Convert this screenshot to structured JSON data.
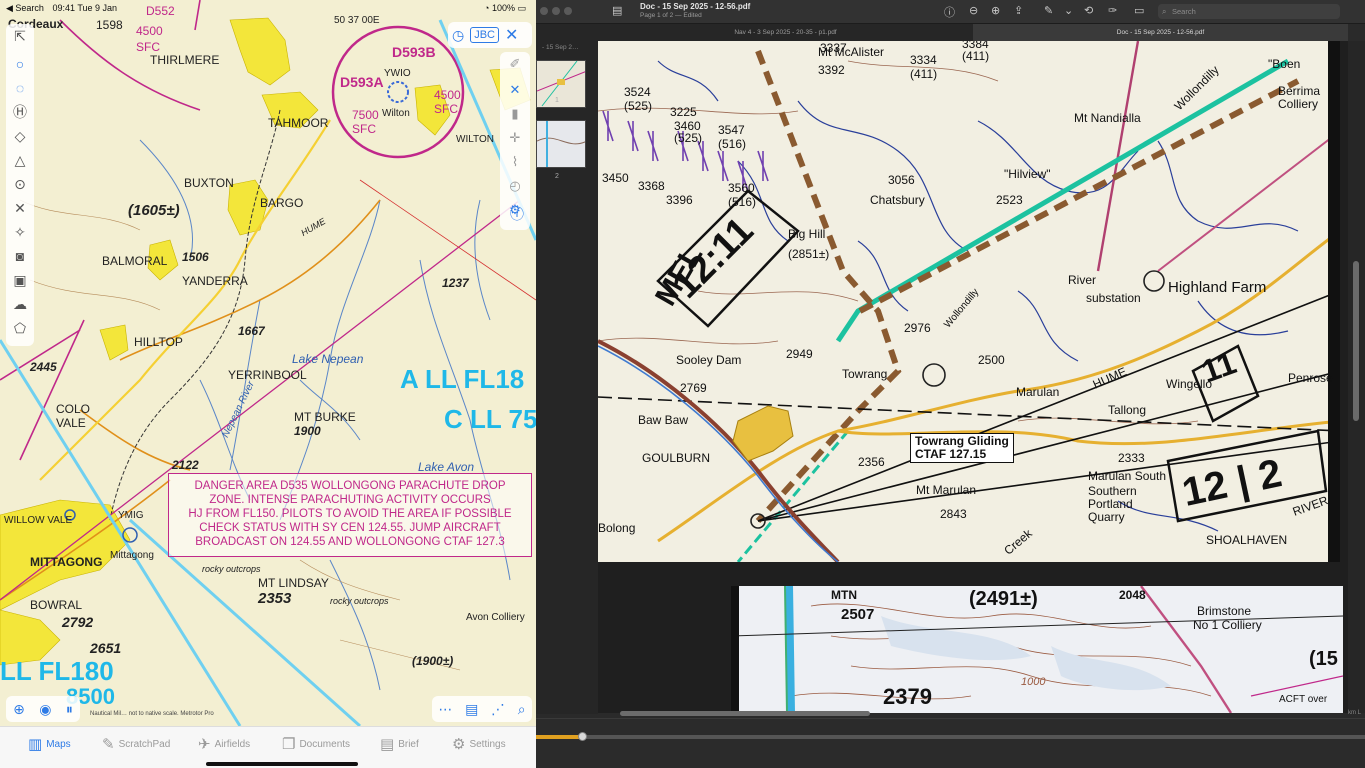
{
  "ipad": {
    "status": {
      "back": "◀ Search",
      "time": "09:41",
      "date": "Tue 9 Jan",
      "battery": "100%"
    },
    "map_labels": [
      {
        "id": "thirlmere",
        "text": "THIRLMERE"
      },
      {
        "id": "tahmoor",
        "text": "TAHMOOR"
      },
      {
        "id": "buxton",
        "text": "BUXTON"
      },
      {
        "id": "bargo",
        "text": "BARGO"
      },
      {
        "id": "balmoral",
        "text": "BALMORAL"
      },
      {
        "id": "yanderra",
        "text": "YANDERRA"
      },
      {
        "id": "hilltop",
        "text": "HILLTOP"
      },
      {
        "id": "yerrinbool",
        "text": "YERRINBOOL"
      },
      {
        "id": "colo",
        "text": "COLO"
      },
      {
        "id": "vale",
        "text": "VALE"
      },
      {
        "id": "willow-vale",
        "text": "WILLOW VALE"
      },
      {
        "id": "mittagong",
        "text": "MITTAGONG"
      },
      {
        "id": "mittagong-ad",
        "text": "Mittagong"
      },
      {
        "id": "ymig",
        "text": "YMIG"
      },
      {
        "id": "bowral",
        "text": "BOWRAL"
      },
      {
        "id": "wilton",
        "text": "Wilton"
      },
      {
        "id": "ywio",
        "text": "YWIO"
      },
      {
        "id": "wilton2",
        "text": "WILTON"
      },
      {
        "id": "mt-burke",
        "text": "MT BURKE"
      },
      {
        "id": "mt-lindsay",
        "text": "MT LINDSAY"
      },
      {
        "id": "lake-nepean",
        "text": "Lake Nepean"
      },
      {
        "id": "lake-avon",
        "text": "Lake Avon"
      },
      {
        "id": "nepean-river",
        "text": "Nepean River"
      },
      {
        "id": "avon-colliery",
        "text": "Avon Colliery"
      },
      {
        "id": "rocky1",
        "text": "rocky outcrops"
      },
      {
        "id": "rocky2",
        "text": "rocky outcrops"
      },
      {
        "id": "hume",
        "text": "HUME"
      },
      {
        "id": "h1605",
        "text": "(1605±)"
      },
      {
        "id": "h1506",
        "text": "1506"
      },
      {
        "id": "h1667",
        "text": "1667"
      },
      {
        "id": "h1900",
        "text": "1900"
      },
      {
        "id": "h2122",
        "text": "2122"
      },
      {
        "id": "h2445",
        "text": "2445"
      },
      {
        "id": "h2353",
        "text": "2353"
      },
      {
        "id": "h2792",
        "text": "2792"
      },
      {
        "id": "h2651",
        "text": "2651"
      },
      {
        "id": "h1237",
        "text": "1237"
      },
      {
        "id": "h1900b",
        "text": "(1900±)"
      },
      {
        "id": "h1598",
        "text": "1598"
      },
      {
        "id": "d593b",
        "text": "D593B"
      },
      {
        "id": "d593a",
        "text": "D593A"
      },
      {
        "id": "s4500a",
        "text": "4500"
      },
      {
        "id": "sfc1",
        "text": "SFC"
      },
      {
        "id": "s4500b",
        "text": "4500"
      },
      {
        "id": "sfc2",
        "text": "SFC"
      },
      {
        "id": "s7500",
        "text": "7500"
      },
      {
        "id": "sfc3",
        "text": "SFC"
      },
      {
        "id": "d552",
        "text": "D552"
      },
      {
        "id": "coord",
        "text": "50 37 00E"
      },
      {
        "id": "a-ll-fl18",
        "text": "A LL FL18"
      },
      {
        "id": "c-ll-75",
        "text": "C LL 75"
      },
      {
        "id": "ll-fl180",
        "text": "LL FL180"
      },
      {
        "id": "n8500",
        "text": "8500"
      },
      {
        "id": "cordeaux",
        "text": "Cordeaux"
      }
    ],
    "danger_box": [
      "DANGER AREA D535 WOLLONGONG PARACHUTE DROP",
      "ZONE. INTENSE PARACHUTING ACTIVITY OCCURS",
      "HJ FROM FL150. PILOTS TO AVOID THE AREA IF POSSIBLE",
      "CHECK STATUS WITH SY CEN 124.55. JUMP AIRCRAFT",
      "BROADCAST ON 124.55 AND WOLLONGONG CTAF 127.3"
    ],
    "pill": {
      "jbc": "JBC"
    },
    "scale_note": "Nautical Mil… not to native scale. Metrotor Pro",
    "tabs": [
      {
        "icon": "map-icon",
        "glyph": "▥",
        "label": "Maps",
        "active": true
      },
      {
        "icon": "scratchpad-icon",
        "glyph": "✎",
        "label": "ScratchPad",
        "active": false
      },
      {
        "icon": "airfields-icon",
        "glyph": "✈",
        "label": "Airfields",
        "active": false
      },
      {
        "icon": "documents-icon",
        "glyph": "❐",
        "label": "Documents",
        "active": false
      },
      {
        "icon": "brief-icon",
        "glyph": "▤",
        "label": "Brief",
        "active": false
      },
      {
        "icon": "settings-icon",
        "glyph": "⚙",
        "label": "Settings",
        "active": false
      }
    ]
  },
  "preview": {
    "title": "Doc - 15 Sep 2025 - 12-56.pdf",
    "subtitle": "Page 1 of 2 — Edited",
    "search_placeholder": "Search",
    "tabs": [
      {
        "label": "Nav 4 - 3 Sep 2025 - 20-35 - p1.pdf",
        "active": false
      },
      {
        "label": "Doc - 15 Sep 2025 - 12-56.pdf",
        "active": true
      }
    ],
    "sidebar_head": "- 15 Sep 2…",
    "thumb_nums": [
      "1",
      "2"
    ],
    "page1_labels": [
      {
        "id": "mt-mcalister",
        "text": "Mt McAlister"
      },
      {
        "id": "h3337",
        "text": "3337"
      },
      {
        "id": "h3392",
        "text": "3392"
      },
      {
        "id": "h3334",
        "text": "3334"
      },
      {
        "id": "h411",
        "text": "(411)"
      },
      {
        "id": "h3384",
        "text": "3384"
      },
      {
        "id": "h411b",
        "text": "(411)"
      },
      {
        "id": "h3524",
        "text": "3524"
      },
      {
        "id": "h525a",
        "text": "(525)"
      },
      {
        "id": "h3225",
        "text": "3225"
      },
      {
        "id": "h3460",
        "text": "3460"
      },
      {
        "id": "h525b",
        "text": "(525)"
      },
      {
        "id": "h3547",
        "text": "3547"
      },
      {
        "id": "h516",
        "text": "(516)"
      },
      {
        "id": "h3450",
        "text": "3450"
      },
      {
        "id": "h3368",
        "text": "3368"
      },
      {
        "id": "h3396",
        "text": "3396"
      },
      {
        "id": "h3560",
        "text": "3560"
      },
      {
        "id": "h516b",
        "text": "(516)"
      },
      {
        "id": "mt-nandialla",
        "text": "Mt Nandialla"
      },
      {
        "id": "chatsbury",
        "text": "Chatsbury"
      },
      {
        "id": "h3056",
        "text": "3056"
      },
      {
        "id": "hilview",
        "text": "\"Hilview\""
      },
      {
        "id": "h2523",
        "text": "2523"
      },
      {
        "id": "big-hill",
        "text": "Big Hill"
      },
      {
        "id": "h2851",
        "text": "(2851±)"
      },
      {
        "id": "highland-farm",
        "text": "Highland Farm"
      },
      {
        "id": "substation",
        "text": "substation"
      },
      {
        "id": "river",
        "text": "River"
      },
      {
        "id": "h2976",
        "text": "2976"
      },
      {
        "id": "h2949",
        "text": "2949"
      },
      {
        "id": "h2500",
        "text": "2500"
      },
      {
        "id": "wollondilly",
        "text": "Wollondilly"
      },
      {
        "id": "sooley-dam",
        "text": "Sooley Dam"
      },
      {
        "id": "h2769",
        "text": "2769"
      },
      {
        "id": "towrang",
        "text": "Towrang"
      },
      {
        "id": "marulan",
        "text": "Marulan"
      },
      {
        "id": "hume2",
        "text": "HUME"
      },
      {
        "id": "wingello",
        "text": "Wingello"
      },
      {
        "id": "tallong",
        "text": "Tallong"
      },
      {
        "id": "penrose",
        "text": "Penrose"
      },
      {
        "id": "baw-baw",
        "text": "Baw Baw"
      },
      {
        "id": "goulburn",
        "text": "GOULBURN"
      },
      {
        "id": "h2356",
        "text": "2356"
      },
      {
        "id": "mt-marulan",
        "text": "Mt Marulan"
      },
      {
        "id": "h2843",
        "text": "2843"
      },
      {
        "id": "h2333",
        "text": "2333"
      },
      {
        "id": "marulan-south",
        "text": "Marulan South"
      },
      {
        "id": "southern-portland",
        "text": "Southern Portland Quarry"
      },
      {
        "id": "shoalhaven",
        "text": "SHOALHAVEN"
      },
      {
        "id": "river2",
        "text": "RIVER"
      },
      {
        "id": "creek",
        "text": "Creek"
      },
      {
        "id": "bolong",
        "text": "Bolong"
      },
      {
        "id": "boen",
        "text": "\"Boen"
      },
      {
        "id": "berrima",
        "text": "Berrima Colliery"
      },
      {
        "id": "wollondilly2",
        "text": "Wollondilly"
      },
      {
        "id": "ctaf-line1",
        "text": "Towrang Gliding"
      },
      {
        "id": "ctaf-line2",
        "text": "CTAF 127.15"
      },
      {
        "id": "hw-1",
        "text": "12 | 2"
      },
      {
        "id": "hw-2",
        "text": "11"
      },
      {
        "id": "hw-3",
        "text": "12:11"
      },
      {
        "id": "hw-4",
        "text": "MEL"
      }
    ],
    "page2_labels": [
      {
        "id": "mtn",
        "text": "MTN"
      },
      {
        "id": "h2507",
        "text": "2507"
      },
      {
        "id": "h2491",
        "text": "(2491±)"
      },
      {
        "id": "h2048",
        "text": "2048"
      },
      {
        "id": "brimstone",
        "text": "Brimstone"
      },
      {
        "id": "no1-colliery",
        "text": "No 1 Colliery"
      },
      {
        "id": "h2379",
        "text": "2379"
      },
      {
        "id": "h1000",
        "text": "1000"
      },
      {
        "id": "h15",
        "text": "(15"
      },
      {
        "id": "acft",
        "text": "ACFT over"
      }
    ],
    "edge_label": "km L"
  }
}
